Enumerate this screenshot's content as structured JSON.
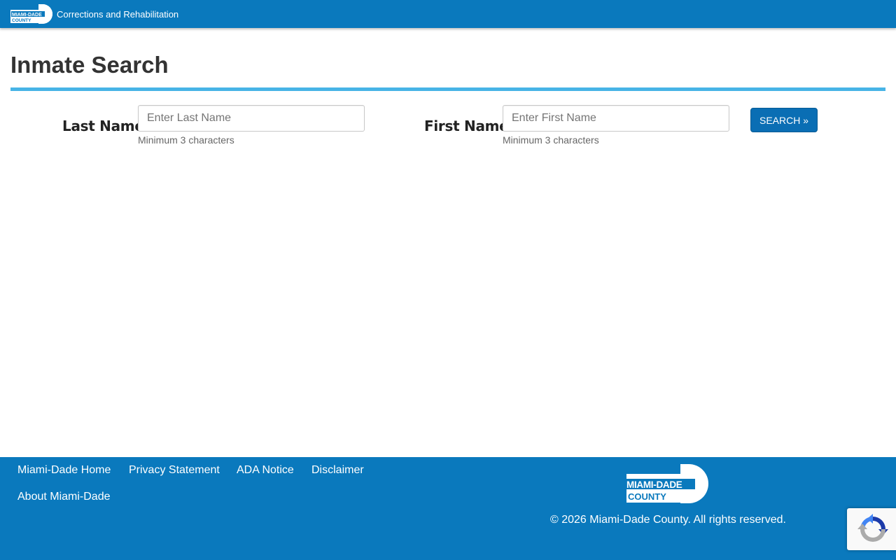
{
  "header": {
    "logo": {
      "line1": "MIAMI-DADE",
      "line2": "COUNTY"
    },
    "site_title": "Corrections and Rehabilitation"
  },
  "page": {
    "title": "Inmate Search"
  },
  "form": {
    "last_name": {
      "label": "Last Name",
      "value": "",
      "placeholder": "Enter Last Name",
      "hint": "Minimum 3 characters"
    },
    "first_name": {
      "label": "First Name",
      "value": "",
      "placeholder": "Enter First Name",
      "hint": "Minimum 3 characters"
    },
    "search_button": "SEARCH »"
  },
  "footer": {
    "links": [
      "Miami-Dade Home",
      "Privacy Statement",
      "ADA Notice",
      "Disclaimer",
      "About Miami-Dade"
    ],
    "logo": {
      "line1": "MIAMI-DADE",
      "line2": "COUNTY"
    },
    "copyright": "© 2026 Miami-Dade County. All rights reserved."
  },
  "recaptcha": {
    "icon": "recaptcha-icon"
  },
  "colors": {
    "brand_blue": "#0a79bd",
    "accent_rule": "#47b4e6",
    "button_blue": "#0a6eb4"
  }
}
